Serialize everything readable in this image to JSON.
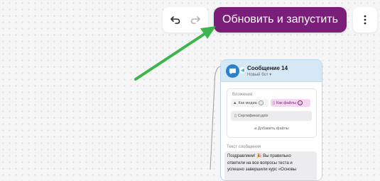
{
  "toolbar": {
    "undo_icon": "undo-icon",
    "redo_icon": "redo-icon",
    "run_button_label": "Обновить и запустить",
    "more_icon": "more-vertical-icon",
    "accent_color": "#7a1e79"
  },
  "annotation": {
    "arrow_color": "#3cb54a"
  },
  "node": {
    "title": "Сообщение 14",
    "bot_name": "Новый бот",
    "header_color": "#d5e8f6",
    "attachments": {
      "label": "Вложения",
      "as_media_label": "Как медиа",
      "as_files_label": "Как файлы",
      "file_name": "Сертификат.pptx",
      "add_files_label": "Добавить файлы"
    },
    "message": {
      "label": "Текст сообщения",
      "line1": "Поздравляем! 🎉 Вы правильно",
      "line2": "ответили на все вопросы теста и",
      "line3": "успешно завершили курс «Основы"
    }
  }
}
